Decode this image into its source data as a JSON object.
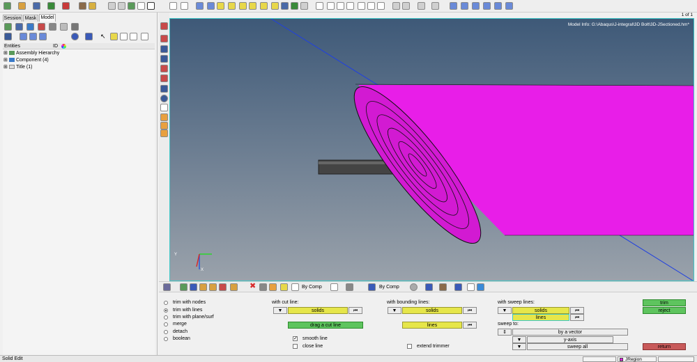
{
  "toolbar": {
    "page_indicator": "1 of 1",
    "icons": [
      "open-file-icon",
      "import-icon",
      "save-icon",
      "export-icon",
      "delete-icon",
      "user-icon",
      "components-icon",
      "undo-icon",
      "redo-icon",
      "refresh-icon",
      "new-icon",
      "window-icon",
      "zoom-icon",
      "arrows-icon",
      "view-icon"
    ]
  },
  "left_panel": {
    "tabs": [
      "Session",
      "Mask",
      "Model"
    ],
    "active_tab": "Model",
    "columns": {
      "entities": "Entities",
      "id": "ID"
    },
    "tree": [
      {
        "label": "Assembly Hierarchy"
      },
      {
        "label": "Component (4)"
      },
      {
        "label": "Title (1)"
      }
    ]
  },
  "viewport": {
    "model_info": "Model Info: G:\\Abaqus\\J-integral\\3D Bolt\\3D-JSectioned.hm*",
    "bg_top": "#3e5978",
    "bg_bottom": "#9aa2ab",
    "model_color": "#e81ee8"
  },
  "bottom_toolbar": {
    "by_comp_1": "By Comp",
    "by_comp_2": "By Comp"
  },
  "options_panel": {
    "radios": [
      {
        "label": "trim with nodes",
        "checked": false
      },
      {
        "label": "trim with lines",
        "checked": true
      },
      {
        "label": "trim with plane/surf",
        "checked": false
      },
      {
        "label": "merge",
        "checked": false
      },
      {
        "label": "detach",
        "checked": false
      },
      {
        "label": "boolean",
        "checked": false
      }
    ],
    "cut_line": {
      "header": "with cut line:",
      "solids": "solids",
      "drag": "drag a cut line",
      "smooth_line": "smooth line",
      "close_line": "close line"
    },
    "bounding": {
      "header": "with bounding lines:",
      "solids": "solids",
      "lines": "lines",
      "extend_trimmer": "extend trimmer"
    },
    "sweep": {
      "header": "with sweep lines:",
      "solids": "solids",
      "lines": "lines",
      "sweep_to": "sweep to:",
      "by_vector": "by a vector",
      "y_axis": "y-axis",
      "sweep_all": "sweep all"
    },
    "actions": {
      "trim": "trim",
      "reject": "reject",
      "return": "return"
    }
  },
  "status_bar": {
    "mode": "Solid Edit",
    "region": "JRegion"
  }
}
